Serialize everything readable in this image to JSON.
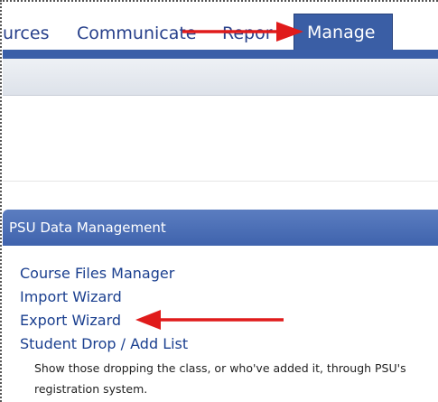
{
  "nav": {
    "tabs": [
      {
        "label": "urces"
      },
      {
        "label": "Communicate"
      },
      {
        "label": "Repor"
      },
      {
        "label": "Manage",
        "active": true
      }
    ]
  },
  "panel": {
    "title": "PSU Data Management",
    "links": [
      {
        "label": "Course Files Manager"
      },
      {
        "label": "Import Wizard"
      },
      {
        "label": "Export Wizard"
      },
      {
        "label": "Student Drop / Add List"
      }
    ],
    "description": "Show those dropping the class, or who've added it, through PSU's registration system."
  },
  "colors": {
    "accent_blue": "#3a5fa8",
    "link_blue": "#1a3f8f",
    "annotation_red": "#e01b1b"
  }
}
